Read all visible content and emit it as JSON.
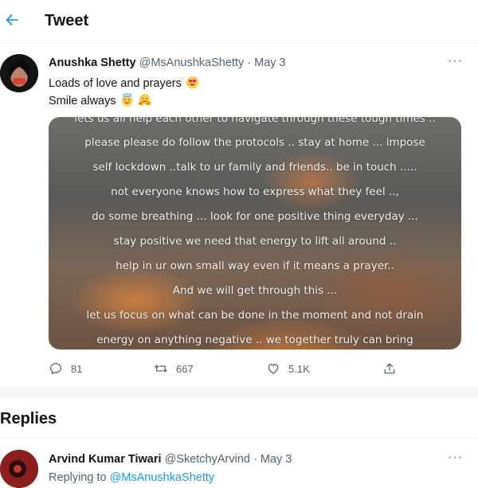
{
  "header": {
    "title": "Tweet"
  },
  "tweet": {
    "author_name": "Anushka Shetty",
    "author_handle": "@MsAnushkaShetty",
    "separator": "·",
    "date": "May 3",
    "more": "···",
    "text_line1": "Loads of love and prayers",
    "text_line2": "Smile always",
    "emojis_line1": [
      "heart-eyes-emoji"
    ],
    "emojis_line2": [
      "halo-smile-emoji",
      "hugging-emoji"
    ],
    "image_lines": [
      "lets us all help each other to navigate through these tough times ..",
      "please please do follow the protocols .. stay at home ... impose",
      "self lockdown ..talk to ur family and friends.. be in touch .....",
      "not everyone knows how to express what they feel ..,",
      "do some breathing ... look for one positive thing everyday ...",
      "stay positive we need that energy to lift all around ..",
      "help in ur own small way even if it means a prayer..",
      "And we will get through this ...",
      "let us focus on what can be done in the moment and not drain",
      "energy on anything negative .. we together truly can bring"
    ],
    "replies_count": "81",
    "retweets_count": "667",
    "likes_count": "5.1K"
  },
  "replies_section": {
    "title": "Replies",
    "first_reply": {
      "author_name": "Arvind Kumar Tiwari",
      "author_handle": "@SketchyArvind",
      "separator": "·",
      "date": "May 3",
      "more": "···",
      "replying_prefix": "Replying to",
      "replying_handle": "@MsAnushkaShetty"
    }
  },
  "colors": {
    "accent": "#1d9bf0",
    "muted": "#536471",
    "text": "#0f1419"
  }
}
